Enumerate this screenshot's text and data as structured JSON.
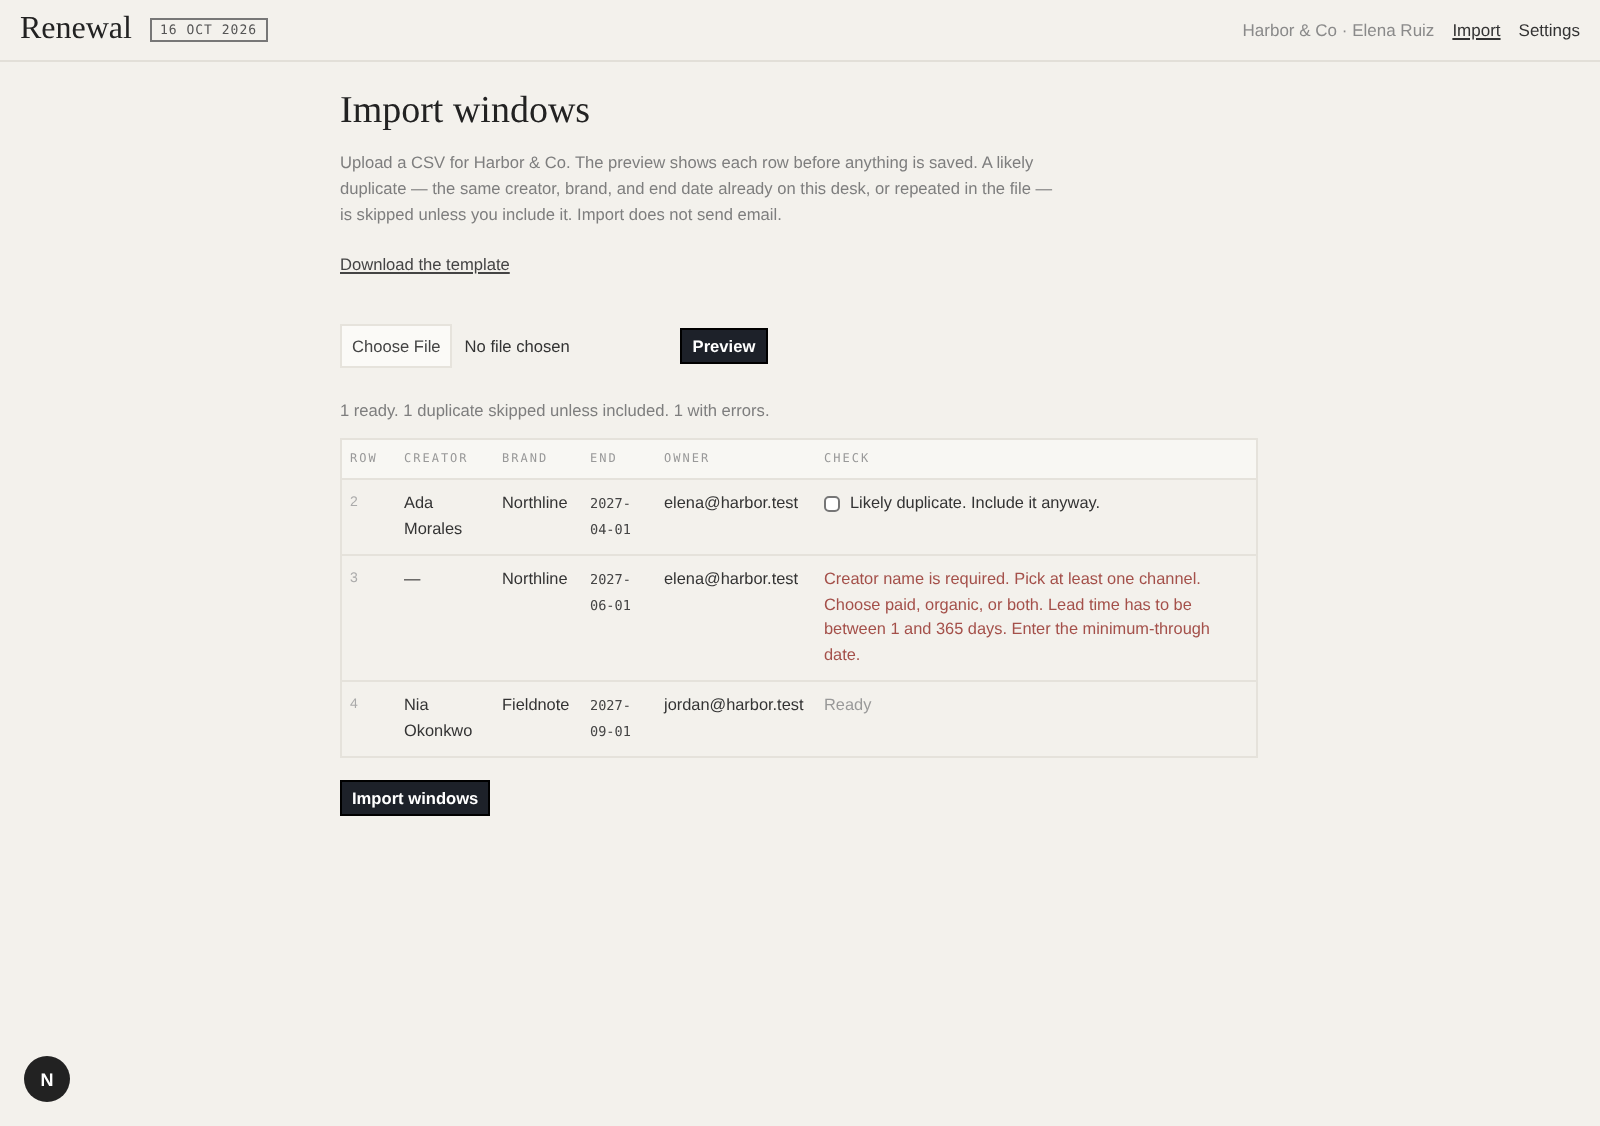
{
  "header": {
    "brand": "Renewal",
    "date_stamp": "16 OCT 2026",
    "account": "Harbor & Co · Elena Ruiz",
    "nav": [
      {
        "label": "Import",
        "selected": true
      },
      {
        "label": "Settings",
        "selected": false
      }
    ]
  },
  "page": {
    "title": "Import windows",
    "intro": "Upload a CSV for Harbor & Co. The preview shows each row before anything is saved. A likely duplicate — the same creator, brand, and end date already on this desk, or repeated in the file — is skipped unless you include it. Import does not send email.",
    "template_link": "Download the template"
  },
  "upload": {
    "choose_button": "Choose File",
    "file_status": "No file chosen",
    "preview_button": "Preview"
  },
  "summary": "1 ready. 1 duplicate skipped unless included. 1 with errors.",
  "table": {
    "columns": [
      "ROW",
      "CREATOR",
      "BRAND",
      "END",
      "OWNER",
      "CHECK"
    ],
    "rows": [
      {
        "row": "2",
        "creator": "Ada Morales",
        "brand": "Northline",
        "end": "2027-04-01",
        "owner": "elena@harbor.test",
        "check": {
          "kind": "duplicate",
          "text": "Likely duplicate. Include it anyway.",
          "checked": false
        }
      },
      {
        "row": "3",
        "creator": "—",
        "brand": "Northline",
        "end": "2027-06-01",
        "owner": "elena@harbor.test",
        "check": {
          "kind": "error",
          "text": "Creator name is required. Pick at least one channel. Choose paid, organic, or both. Lead time has to be between 1 and 365 days. Enter the minimum-through date."
        }
      },
      {
        "row": "4",
        "creator": "Nia Okonkwo",
        "brand": "Fieldnote",
        "end": "2027-09-01",
        "owner": "jordan@harbor.test",
        "check": {
          "kind": "ready",
          "text": "Ready"
        }
      }
    ]
  },
  "import_button": "Import windows",
  "dev_badge": "N"
}
